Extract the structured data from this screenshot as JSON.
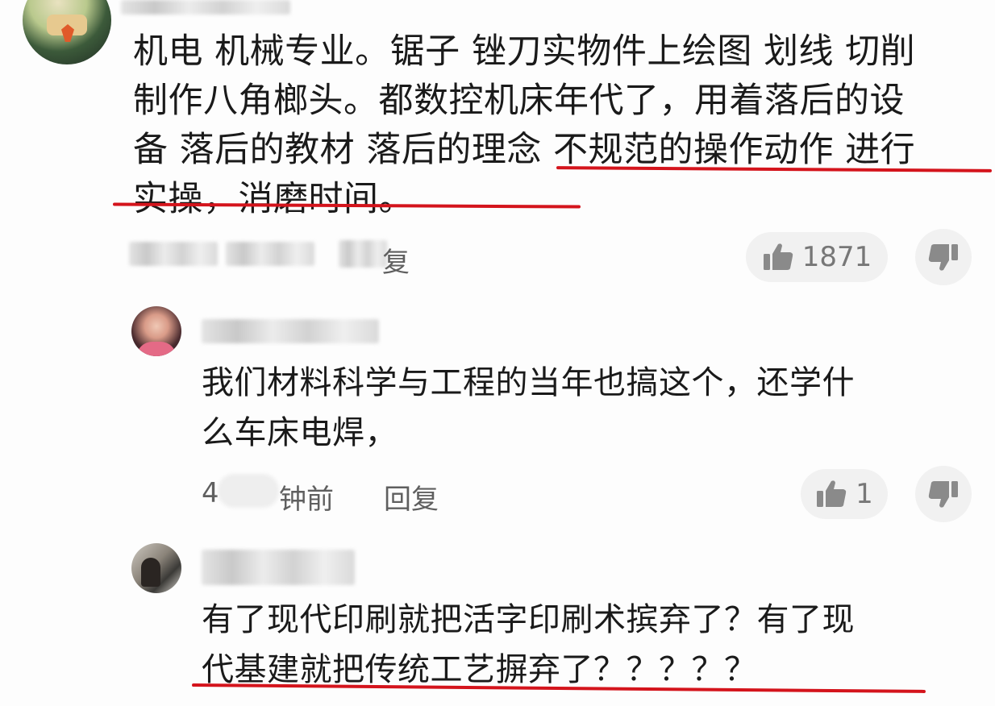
{
  "main_comment": {
    "text_line1": "机电 机械专业。锯子 锉刀实物件上绘图 划线 切削",
    "text_line2": "制作八角榔头。都数控机床年代了，用着落后的设",
    "text_line3": "备 落后的教材 落后的理念 不规范的操作动作 进行",
    "text_line4": "实操，消磨时间。",
    "reply_label": "复",
    "like_count": "1871"
  },
  "replies": [
    {
      "text_line1": "我们材料科学与工程的当年也搞这个，还学什",
      "text_line2": "么车床电焊，",
      "time_prefix": "4",
      "time_suffix": "钟前",
      "reply_label": "回复",
      "like_count": "1"
    },
    {
      "text_line1": "有了现代印刷就把活字印刷术摈弃了？有了现",
      "text_line2": "代基建就把传统工艺摒弃了？？？？？"
    }
  ],
  "icons": {
    "like": "thumbs-up-icon",
    "dislike": "thumbs-down-icon"
  },
  "colors": {
    "underline": "#d4141c",
    "meta_text": "#5f5f5f",
    "pill_bg": "#f1f1f1"
  }
}
